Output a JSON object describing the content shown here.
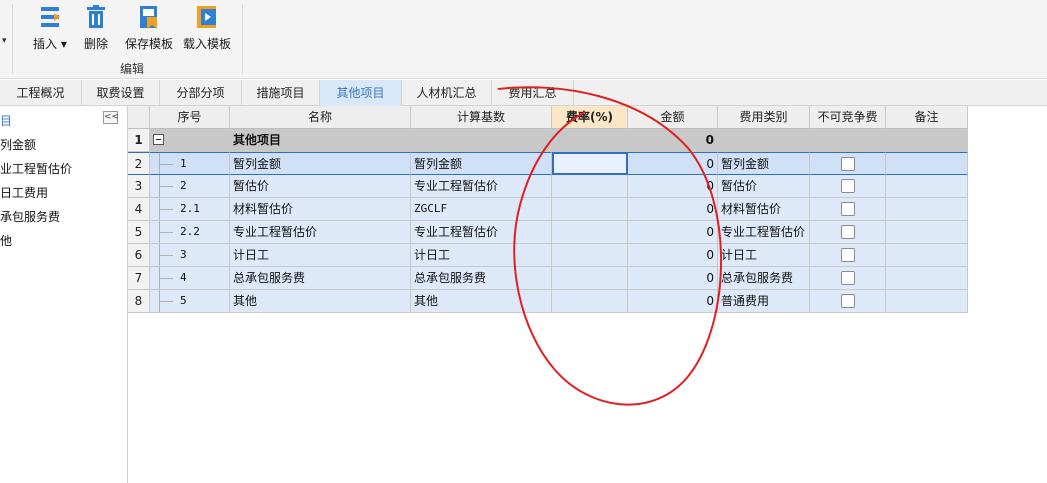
{
  "ribbon": {
    "insert_label": "插入",
    "delete_label": "删除",
    "save_template_label": "保存模板",
    "load_template_label": "载入模板",
    "group_label": "编辑"
  },
  "tabs": [
    "工程概况",
    "取费设置",
    "分部分项",
    "措施项目",
    "其他项目",
    "人材机汇总",
    "费用汇总"
  ],
  "active_tab": "其他项目",
  "left_panel": {
    "items": [
      "目",
      "列金额",
      "业工程暂估价",
      "日工费用",
      "承包服务费",
      "他"
    ]
  },
  "grid": {
    "columns": [
      "",
      "序号",
      "名称",
      "计算基数",
      "费率(%)",
      "金额",
      "费用类别",
      "不可竞争费",
      "备注"
    ],
    "group_row": {
      "row_no": "1",
      "name": "其他项目",
      "amount": "0"
    },
    "rows": [
      {
        "row_no": "2",
        "seq": "1",
        "name": "暂列金额",
        "base": "暂列金额",
        "rate": "",
        "amount": "0",
        "category": "暂列金额",
        "uncompetitive": false,
        "note": ""
      },
      {
        "row_no": "3",
        "seq": "2",
        "name": "暂估价",
        "base": "专业工程暂估价",
        "rate": "",
        "amount": "0",
        "category": "暂估价",
        "uncompetitive": false,
        "note": ""
      },
      {
        "row_no": "4",
        "seq": "2.1",
        "name": "材料暂估价",
        "base": "ZGCLF",
        "rate": "",
        "amount": "0",
        "category": "材料暂估价",
        "uncompetitive": false,
        "note": ""
      },
      {
        "row_no": "5",
        "seq": "2.2",
        "name": "专业工程暂估价",
        "base": "专业工程暂估价",
        "rate": "",
        "amount": "0",
        "category": "专业工程暂估价",
        "uncompetitive": false,
        "note": ""
      },
      {
        "row_no": "6",
        "seq": "3",
        "name": "计日工",
        "base": "计日工",
        "rate": "",
        "amount": "0",
        "category": "计日工",
        "uncompetitive": false,
        "note": ""
      },
      {
        "row_no": "7",
        "seq": "4",
        "name": "总承包服务费",
        "base": "总承包服务费",
        "rate": "",
        "amount": "0",
        "category": "总承包服务费",
        "uncompetitive": false,
        "note": ""
      },
      {
        "row_no": "8",
        "seq": "5",
        "name": "其他",
        "base": "其他",
        "rate": "",
        "amount": "0",
        "category": "普通费用",
        "uncompetitive": false,
        "note": ""
      }
    ]
  },
  "colors": {
    "accent": "#2e6fc5",
    "selected_tab_bg": "#d9e8f9",
    "row_bg": "#dde9f9",
    "group_bg": "#c8c8c8",
    "rate_header_bg": "#fbe7c7",
    "annotation": "#e02020"
  },
  "icons": {
    "insert": "insert-rows-icon",
    "delete": "trash-icon",
    "save_template": "save-template-icon",
    "load_template": "load-template-icon"
  }
}
